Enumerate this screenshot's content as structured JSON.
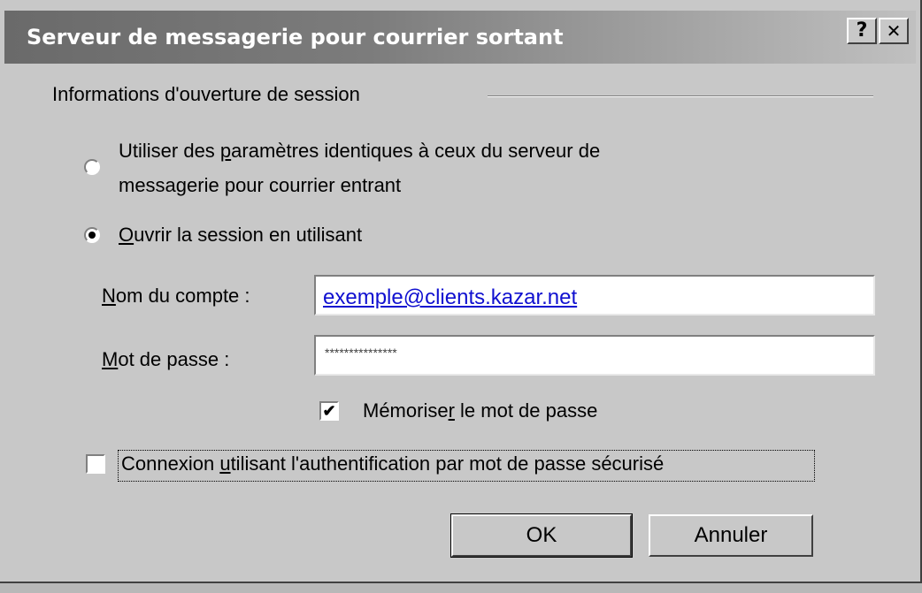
{
  "dialog": {
    "title": "Serveur de messagerie pour courrier sortant",
    "help_label": "?",
    "close_label": "✕"
  },
  "group": {
    "label": "Informations d'ouverture de session"
  },
  "options": {
    "same_settings": {
      "line1_pre": "Utiliser des ",
      "line1_accel": "p",
      "line1_post": "aramètres identiques à ceux du serveur de",
      "line2": "messagerie pour courrier entrant",
      "selected": false
    },
    "login_with": {
      "accel": "O",
      "post": "uvrir la session en utilisant",
      "selected": true
    }
  },
  "account": {
    "label_accel": "N",
    "label_post": "om du compte :",
    "value": "exemple@clients.kazar.net"
  },
  "password": {
    "label_accel": "M",
    "label_post": "ot de passe :",
    "value": "***************"
  },
  "remember": {
    "pre": "Mémorise",
    "accel": "r",
    "post": " le mot de passe",
    "checked": true,
    "check_mark": "✔"
  },
  "secure_auth": {
    "pre": "Connexion ",
    "accel": "u",
    "post": "tilisant l'authentification par mot de passe sécurisé",
    "checked": false
  },
  "buttons": {
    "ok": "OK",
    "cancel": "Annuler"
  }
}
